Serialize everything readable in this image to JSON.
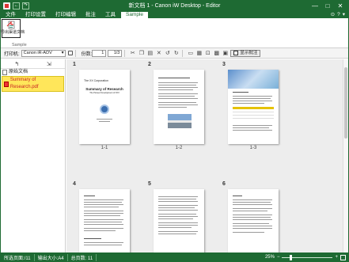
{
  "window": {
    "title": "新文档 1 - Canon iW Desktop - Editor",
    "quick_access": [
      "←",
      "↷"
    ],
    "buttons": [
      "—",
      "□",
      "✕"
    ]
  },
  "menu": {
    "items": [
      "文件",
      "打印设置",
      "打印编辑",
      "批注",
      "工具",
      "Sample"
    ],
    "active_index": 5,
    "right_icons": [
      "⊙",
      "?",
      "▾"
    ]
  },
  "ribbon": {
    "button_label": "导出渠道文档",
    "group_label": "Sample"
  },
  "toolbar": {
    "printer_label": "打印机:",
    "printer_value": "Canon iR-ADV",
    "copies_label": "份数:",
    "copies_value": "1",
    "page_value": "1/3",
    "annotation_label": "显示批注"
  },
  "left_pane": {
    "root_label": "原始文档",
    "file_name": "Summary of Research.pdf"
  },
  "pages": {
    "numbers": [
      "1",
      "2",
      "3",
      "4",
      "5",
      "6"
    ],
    "labels": [
      "1-1",
      "1-2",
      "1-3"
    ],
    "page1_header": "The XX Corporation",
    "page1_title": "Summary of Research",
    "page1_subtitle": "The Pioneer Development of XXX"
  },
  "status": {
    "pages": "所选页面:/11",
    "paper": "输出大小:A4",
    "total": "总页数: 11",
    "zoom": "25%"
  },
  "colors": {
    "brand_green": "#1e6a33",
    "highlight_yellow": "#ffe65a"
  }
}
